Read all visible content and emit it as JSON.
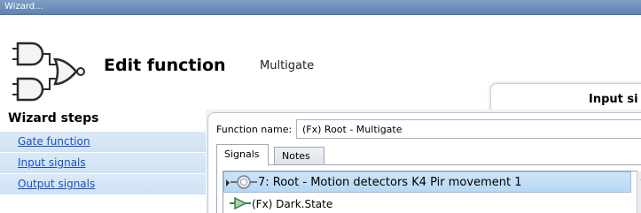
{
  "window": {
    "title": "Wizard..."
  },
  "header": {
    "title": "Edit function",
    "subtitle": "Multigate",
    "panel_label": "Input si",
    "logo_icon": "logic-gates-icon"
  },
  "sidebar": {
    "heading": "Wizard steps",
    "steps": [
      {
        "label": "Gate function"
      },
      {
        "label": "Input signals"
      },
      {
        "label": "Output signals"
      }
    ]
  },
  "main": {
    "function_name_label": "Function name:",
    "function_name_value": "(Fx) Root - Multigate",
    "tabs": [
      {
        "label": "Signals",
        "selected": true
      },
      {
        "label": "Notes",
        "selected": false
      }
    ],
    "signals": [
      {
        "label": "7: Root - Motion detectors K4 Pir movement 1",
        "icon": "motion-sensor-icon",
        "selected": true
      },
      {
        "label": "(Fx) Dark.State",
        "icon": "function-output-icon",
        "selected": false
      }
    ]
  },
  "colors": {
    "titlebar": "#6f91bd",
    "sidebar_step_bg": "#d6e6f6",
    "link": "#1a4fc9",
    "selection": "#c2ddf5"
  }
}
